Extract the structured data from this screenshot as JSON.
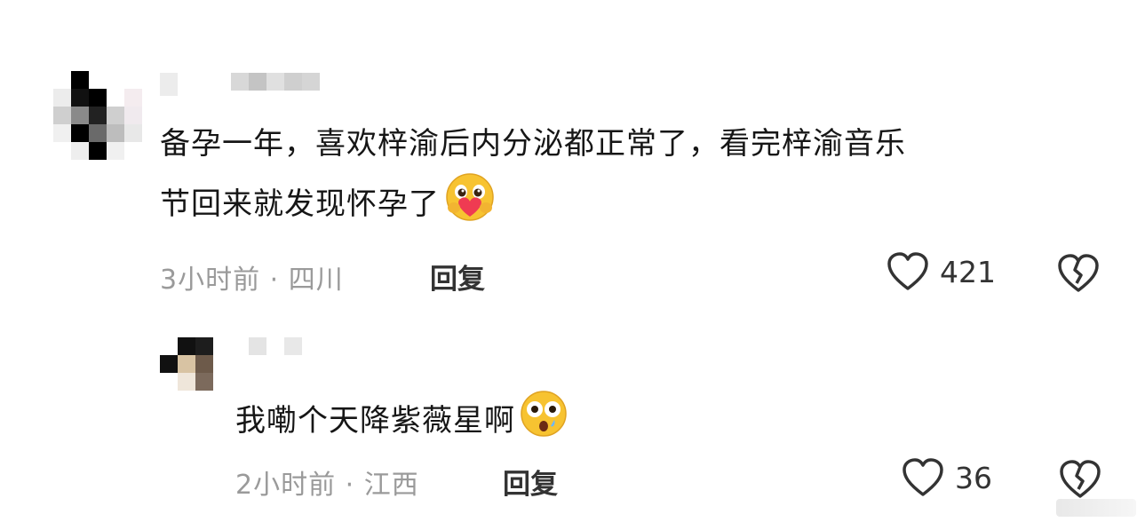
{
  "comments": [
    {
      "text_line1": "备孕一年，喜欢梓渝后内分泌都正常了，看完梓渝音乐",
      "text_line2": "节回来就发现怀孕了",
      "time": "3小时前",
      "location": "四川",
      "separator": "·",
      "reply_label": "回复",
      "like_count": "421",
      "emoji": "emoji-hugging-heart"
    },
    {
      "text": "我嘞个天降紫薇星啊",
      "time": "2小时前",
      "location": "江西",
      "separator": "·",
      "reply_label": "回复",
      "like_count": "36",
      "emoji": "emoji-flushed"
    }
  ],
  "colors": {
    "meta": "#9a9a9a",
    "text": "#161616",
    "icon": "#333333",
    "heart_emoji": "#ef3b52",
    "emoji_face": "#f7c331"
  }
}
